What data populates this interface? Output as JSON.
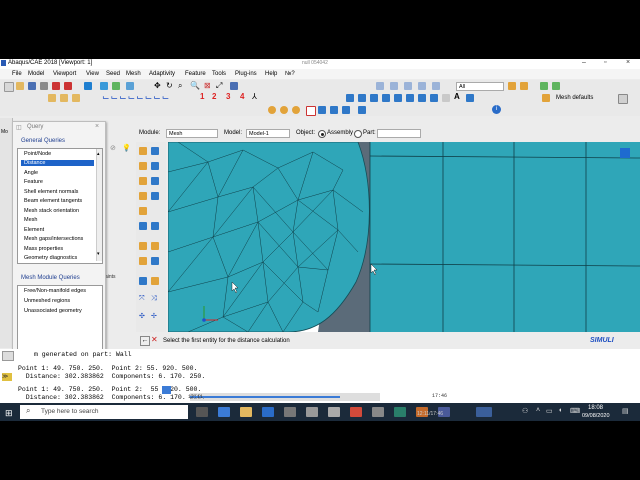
{
  "window": {
    "title": "Abaqus/CAE 2018 [Viewport: 1]",
    "center_text": "null 054042"
  },
  "menu": [
    "File",
    "Model",
    "Viewport",
    "View",
    "Seed",
    "Mesh",
    "Adaptivity",
    "Feature",
    "Tools",
    "Plug-ins",
    "Help",
    "№?"
  ],
  "toolbar": {
    "red_numbers": [
      "1",
      "2",
      "3",
      "4"
    ],
    "filter_value": "All",
    "mesh_defaults": "Mesh defaults"
  },
  "context": {
    "module_label": "Module:",
    "module_value": "Mesh",
    "model_label": "Model:",
    "model_value": "Model-1",
    "object_label": "Object:",
    "assembly": "Assembly",
    "part_label": "Part:"
  },
  "query": {
    "title": "Query",
    "general_heading": "General Queries",
    "general_items": [
      "Point/Node",
      "Distance",
      "Angle",
      "Feature",
      "Shell element normals",
      "Beam element tangents",
      "Mesh stack orientation",
      "Mesh",
      "Element",
      "Mesh gaps/intersections",
      "Mass properties",
      "Geometry diagnostics"
    ],
    "selected": "Distance",
    "module_heading": "Mesh Module Queries",
    "module_items": [
      "Free/Non-manifold edges",
      "Unmeshed regions",
      "Unassociated geometry"
    ]
  },
  "prompt": {
    "text": "Select the first entity for the distance calculation"
  },
  "brand": "SIMULI",
  "side_label_1": "Mo",
  "side_label_2": "aints",
  "messages": [
    "m generated on part: Wall",
    "Point 1: 49. 750. 250.  Point 2: 55. 920. 500.",
    "  Distance: 302.383862  Components: 6. 170. 250.",
    "Point 1: 49. 750. 250.  Point 2:  55  920. 500.",
    "  Distance: 302.383862  Components: 6. 170. 250."
  ],
  "taskbar": {
    "search_placeholder": "Type here to search",
    "time": "18:08",
    "date": "09/08/2020",
    "media_time": "12:11/17:46",
    "media_time2": "17:46",
    "media_small": "12:11"
  },
  "colors": {
    "mesh": "#2fa6b8",
    "selection": "#1e63c8",
    "taskbar": "#1b2a3a"
  }
}
